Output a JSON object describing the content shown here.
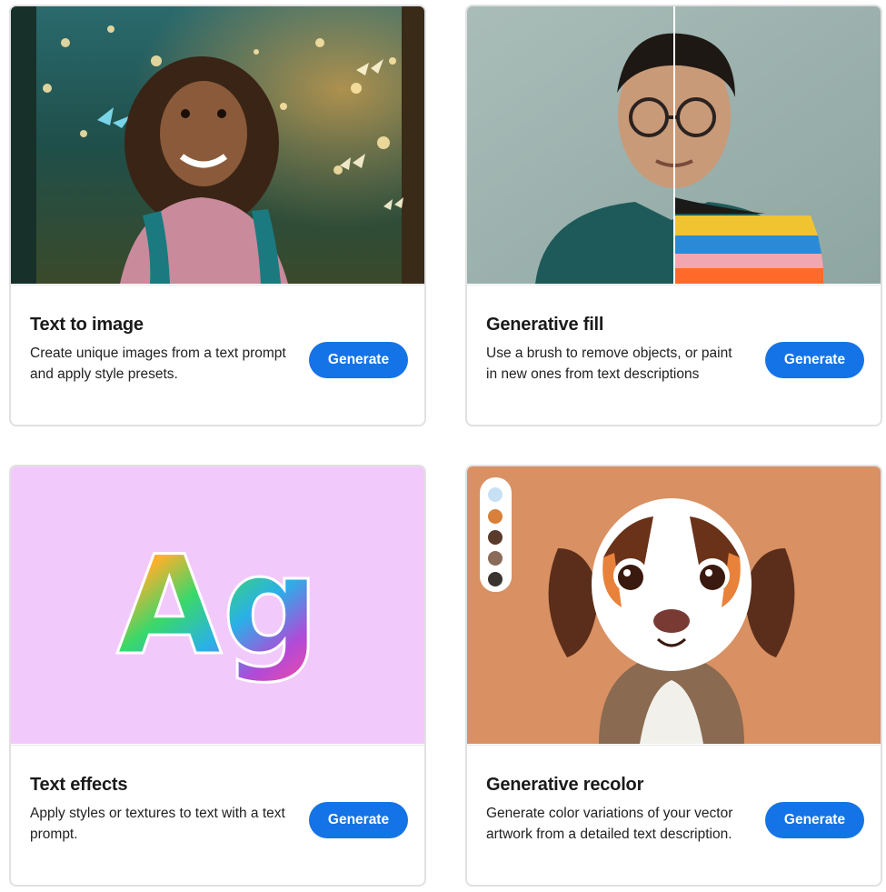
{
  "cards": [
    {
      "title": "Text to image",
      "description": "Create unique images from a text prompt and apply style presets.",
      "button_label": "Generate",
      "image": "girl-in-forest-with-butterflies"
    },
    {
      "title": "Generative fill",
      "description": "Use a brush to remove objects, or paint in new ones from text descriptions",
      "button_label": "Generate",
      "image": "man-with-glasses-split-comparison"
    },
    {
      "title": "Text effects",
      "description": "Apply styles or textures to text with a text prompt.",
      "button_label": "Generate",
      "image": "furry-rainbow-letters",
      "image_text": "Ag"
    },
    {
      "title": "Generative recolor",
      "description": "Generate color variations of your vector artwork from a detailed text description.",
      "button_label": "Generate",
      "image": "illustrated-puppy-with-palette"
    }
  ],
  "colors": {
    "button": "#1473e6",
    "card_border": "#e1e1e1",
    "text_effects_bg": "#f2c9fb",
    "recolor_bg": "#d99063",
    "palette_swatches": [
      "#c8e0f4",
      "#d8803a",
      "#5a3a2a",
      "#8a6a58",
      "#3a3430"
    ]
  }
}
